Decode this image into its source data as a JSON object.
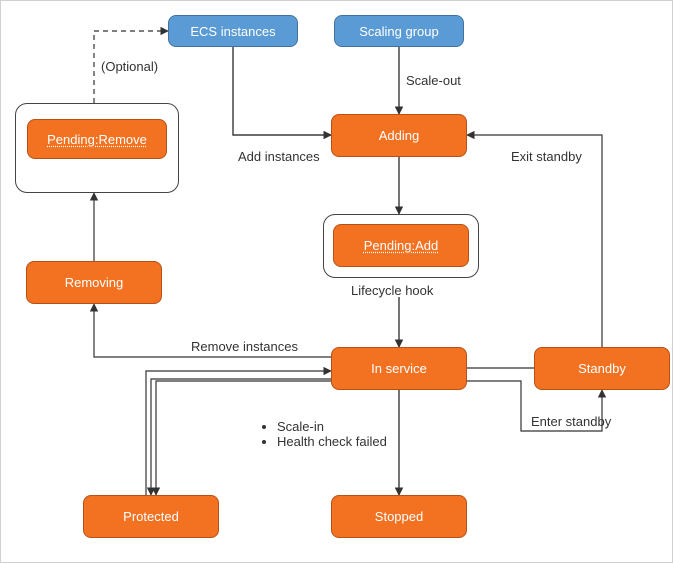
{
  "nodes": {
    "ecs_instances": "ECS instances",
    "scaling_group": "Scaling group",
    "adding": "Adding",
    "pending_add": "Pending:Add",
    "in_service": "In service",
    "standby": "Standby",
    "stopped": "Stopped",
    "protected": "Protected",
    "removing": "Removing",
    "pending_remove": "Pending:Remove"
  },
  "labels": {
    "optional": "(Optional)",
    "scale_out": "Scale-out",
    "add_instances": "Add instances",
    "exit_standby": "Exit standby",
    "lifecycle_hook": "Lifecycle hook",
    "remove_instances": "Remove instances",
    "enter_standby": "Enter standby",
    "bullet_scale_in": "Scale-in",
    "bullet_hc_failed": "Health check failed"
  },
  "colors": {
    "blue_fill": "#5b9bd5",
    "blue_border": "#41719c",
    "orange_fill": "#f27222",
    "orange_border": "#b75015",
    "stroke": "#333333"
  },
  "chart_data": {
    "type": "diagram",
    "title": "ECS Scaling Group Instance Lifecycle",
    "nodes": [
      {
        "id": "ecs_instances",
        "label": "ECS instances",
        "kind": "source",
        "color": "blue"
      },
      {
        "id": "scaling_group",
        "label": "Scaling group",
        "kind": "source",
        "color": "blue"
      },
      {
        "id": "adding",
        "label": "Adding",
        "kind": "state",
        "color": "orange"
      },
      {
        "id": "pending_add",
        "label": "Pending:Add",
        "kind": "hook-state",
        "color": "orange",
        "container": "Lifecycle hook"
      },
      {
        "id": "in_service",
        "label": "In service",
        "kind": "state",
        "color": "orange"
      },
      {
        "id": "standby",
        "label": "Standby",
        "kind": "state",
        "color": "orange"
      },
      {
        "id": "stopped",
        "label": "Stopped",
        "kind": "state",
        "color": "orange"
      },
      {
        "id": "protected",
        "label": "Protected",
        "kind": "state",
        "color": "orange"
      },
      {
        "id": "removing",
        "label": "Removing",
        "kind": "state",
        "color": "orange"
      },
      {
        "id": "pending_remove",
        "label": "Pending:Remove",
        "kind": "hook-state",
        "color": "orange",
        "optional": true
      }
    ],
    "edges": [
      {
        "from": "scaling_group",
        "to": "adding",
        "label": "Scale-out"
      },
      {
        "from": "ecs_instances",
        "to": "adding",
        "label": "Add instances"
      },
      {
        "from": "adding",
        "to": "pending_add",
        "label": ""
      },
      {
        "from": "pending_add",
        "to": "in_service",
        "label": ""
      },
      {
        "from": "in_service",
        "to": "standby",
        "label": "Enter standby"
      },
      {
        "from": "standby",
        "to": "adding",
        "label": "Exit standby"
      },
      {
        "from": "in_service",
        "to": "stopped",
        "label": "",
        "notes": [
          "Scale-in",
          "Health check failed"
        ]
      },
      {
        "from": "in_service",
        "to": "protected",
        "label": "",
        "bidirectional": true
      },
      {
        "from": "in_service",
        "to": "removing",
        "label": "Remove instances"
      },
      {
        "from": "removing",
        "to": "pending_remove",
        "label": ""
      },
      {
        "from": "pending_remove",
        "to": "ecs_instances",
        "label": "(Optional)",
        "style": "dashed"
      }
    ]
  }
}
